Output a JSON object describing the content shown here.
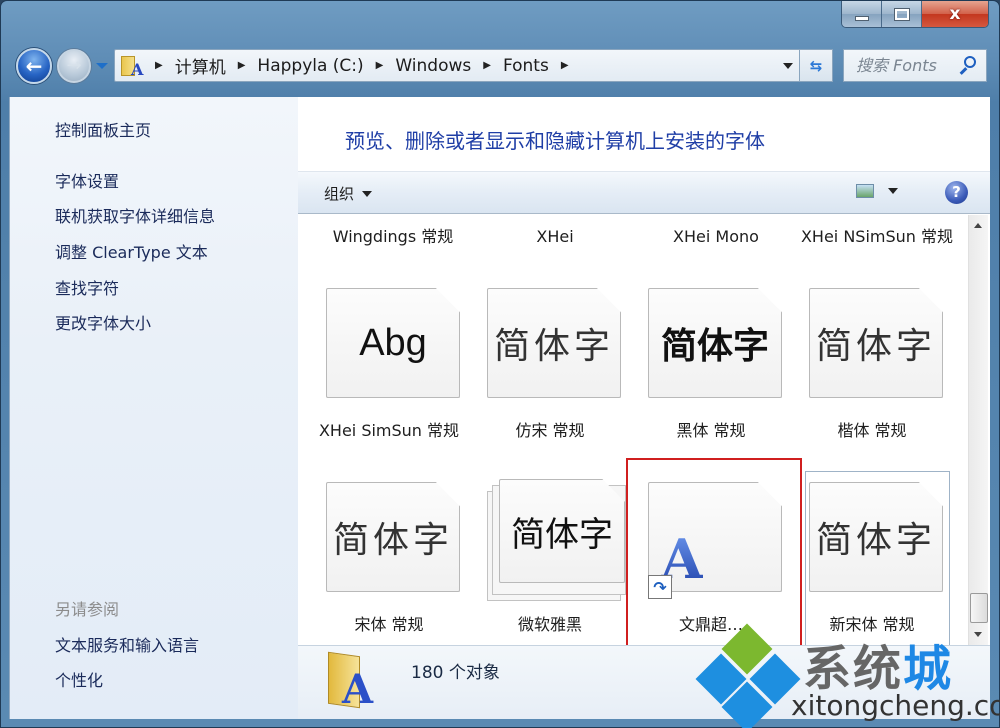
{
  "window": {
    "caption": {
      "minimize_icon": "minimize-icon",
      "maximize_icon": "maximize-icon",
      "close_glyph": "x"
    }
  },
  "nav": {
    "back_glyph": "←",
    "forward_glyph": "→",
    "breadcrumb": [
      "计算机",
      "Happyla (C:)",
      "Windows",
      "Fonts"
    ],
    "separator": "▶",
    "refresh_glyph": "⇆",
    "search_placeholder": "搜索 Fonts"
  },
  "left_pane": {
    "links": [
      "控制面板主页",
      "字体设置",
      "联机获取字体详细信息",
      "调整 ClearType 文本",
      "查找字符",
      "更改字体大小"
    ],
    "see_also_heading": "另请参阅",
    "see_also_links": [
      "文本服务和输入语言",
      "个性化"
    ]
  },
  "content": {
    "title": "预览、删除或者显示和隐藏计算机上安装的字体",
    "toolbar": {
      "organize": "组织",
      "help_glyph": "?"
    },
    "top_row_labels": [
      "Wingdings 常规",
      "XHei",
      "XHei Mono",
      "XHei NSimSun 常规"
    ],
    "fonts": [
      {
        "sample": "Abg",
        "label": "XHei SimSun 常规"
      },
      {
        "sample": "简体字",
        "label": "仿宋 常规"
      },
      {
        "sample": "简体字",
        "label": "黑体 常规"
      },
      {
        "sample": "简体字",
        "label": "楷体 常规"
      },
      {
        "sample": "简体字",
        "label": "宋体 常规"
      },
      {
        "sample": "简体字",
        "label": "微软雅黑"
      },
      {
        "sample": "A",
        "label": "文鼎超…",
        "selected": true,
        "shortcut": true
      },
      {
        "sample": "简体字",
        "label": "新宋体 常规"
      }
    ],
    "shortcut_glyph": "↷"
  },
  "details": {
    "count": "180 个对象",
    "icon_letter": "A"
  },
  "watermark": {
    "text_gray": "系统",
    "text_blue": "城",
    "url": "xitongcheng.com"
  },
  "colors": {
    "title_blue": "#1f3ea6",
    "selection_red": "#d01f1f",
    "link_navy": "#1a2a5a",
    "watermark_green": "#7cb82f",
    "watermark_blue": "#1e88e5"
  }
}
